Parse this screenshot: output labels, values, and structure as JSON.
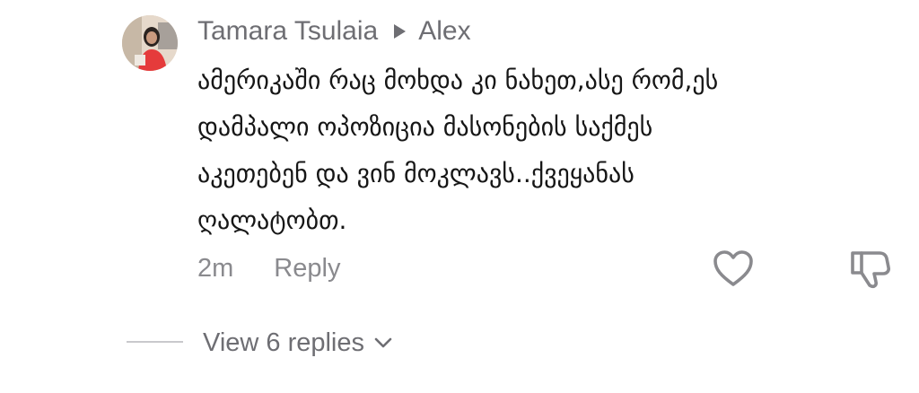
{
  "comment": {
    "author": "Tamara Tsulaia",
    "reply_to": "Alex",
    "lines": [
      "ამერიკაში რაც მოხდა კი ნახეთ,ასე რომ,ეს",
      "დამპალი ოპოზიცია მასონების საქმეს",
      "აკეთებენ და ვინ მოკლავს..ქვეყანას",
      "ღალატობთ."
    ],
    "time": "2m",
    "reply_label": "Reply",
    "view_replies_label": "View 6 replies"
  },
  "icons": {
    "avatar": "avatar",
    "reply_arrow": "reply-arrow-icon",
    "like": "heart-icon",
    "dislike": "thumbs-down-icon",
    "chevron": "chevron-down-icon"
  },
  "colors": {
    "text": "#161616",
    "secondary": "#6e6e73",
    "icon_stroke": "#8a8a8e"
  }
}
